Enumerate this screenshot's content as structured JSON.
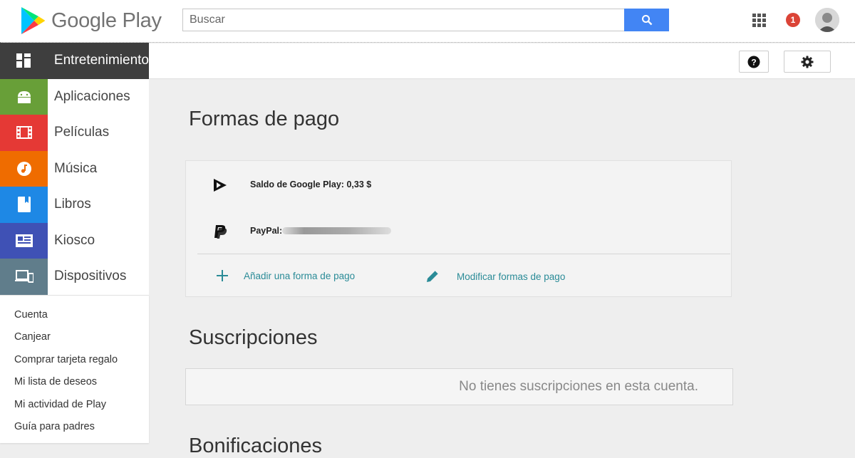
{
  "header": {
    "app_name": "Google Play",
    "search_placeholder": "Buscar",
    "notification_count": "1"
  },
  "sidebar": {
    "items": [
      {
        "label": "Entretenimiento",
        "icon": "grid-icon",
        "color": "#3e3e3e"
      },
      {
        "label": "Aplicaciones",
        "icon": "android-icon",
        "color": "#689f38"
      },
      {
        "label": "Películas",
        "icon": "film-icon",
        "color": "#e53935"
      },
      {
        "label": "Música",
        "icon": "music-icon",
        "color": "#ef6c00"
      },
      {
        "label": "Libros",
        "icon": "book-icon",
        "color": "#1e88e5"
      },
      {
        "label": "Kiosco",
        "icon": "newspaper-icon",
        "color": "#3f51b5"
      },
      {
        "label": "Dispositivos",
        "icon": "devices-icon",
        "color": "#607d8b"
      }
    ],
    "links": [
      "Cuenta",
      "Canjear",
      "Comprar tarjeta regalo",
      "Mi lista de deseos",
      "Mi actividad de Play",
      "Guía para padres"
    ]
  },
  "main": {
    "payment_title": "Formas de pago",
    "balance_label": "Saldo de Google Play: 0,33 $",
    "paypal_label": "PayPal:",
    "add_payment": "Añadir una forma de pago",
    "edit_payment": "Modificar formas de pago",
    "subscriptions_title": "Suscripciones",
    "no_subscriptions": "No tienes suscripciones en esta cuenta.",
    "bonus_title": "Bonificaciones"
  },
  "colors": {
    "accent_teal": "#2a8b97",
    "search_blue": "#4285f4",
    "notification_red": "#db4437"
  }
}
